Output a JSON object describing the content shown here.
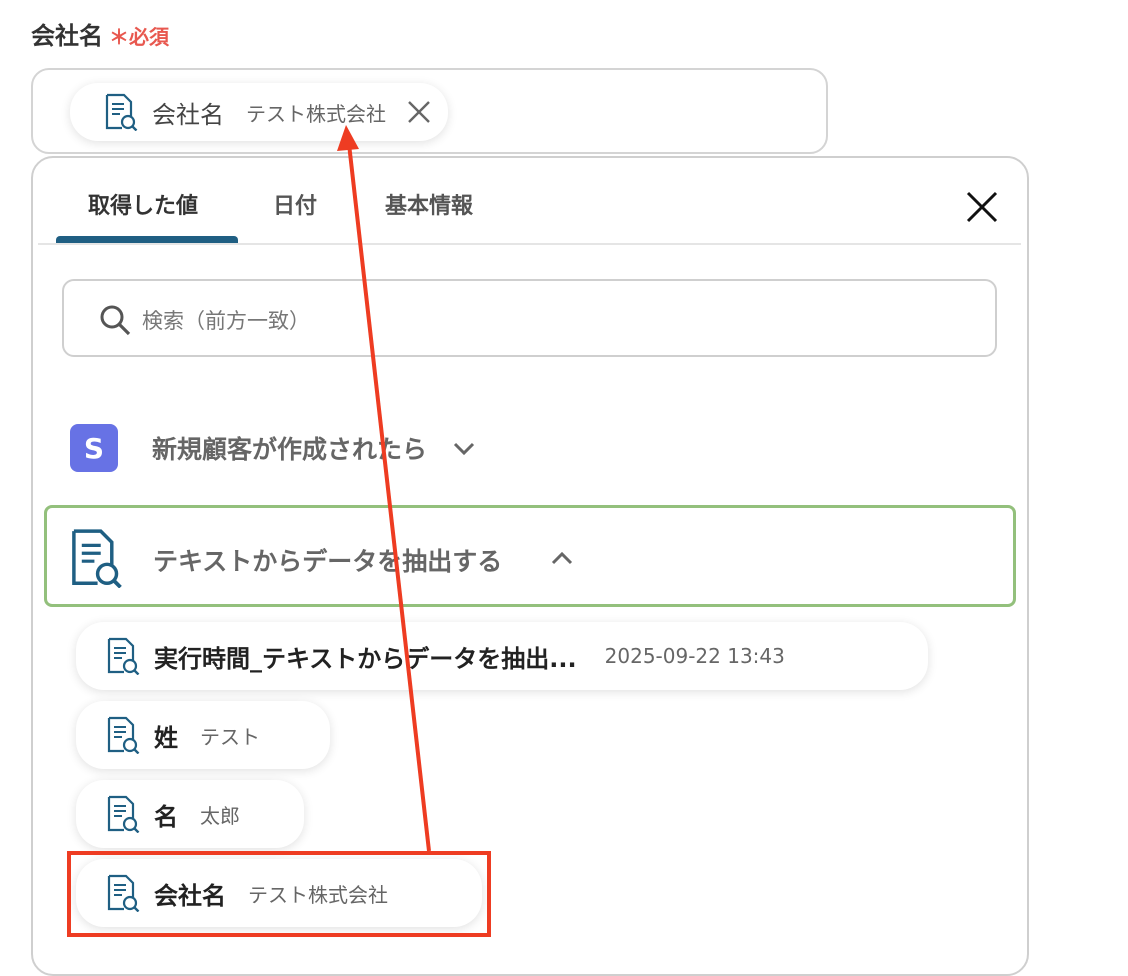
{
  "field": {
    "label": "会社名",
    "required_mark": "＊",
    "required_label": "必須"
  },
  "selected_chip": {
    "key": "会社名",
    "value": "テスト株式会社"
  },
  "tabs": [
    {
      "label": "取得した値",
      "active": true
    },
    {
      "label": "日付",
      "active": false
    },
    {
      "label": "基本情報",
      "active": false
    }
  ],
  "search": {
    "placeholder": "検索（前方一致）"
  },
  "sections": [
    {
      "title": "新規顧客が作成されたら",
      "badge": "S",
      "badge_color": "#6772e5",
      "expanded": false,
      "icon": "stripe-s-badge"
    },
    {
      "title": "テキストからデータを抽出する",
      "expanded": true,
      "icon": "document-search-icon"
    }
  ],
  "items": [
    {
      "key": "実行時間_テキストからデータを抽出...",
      "value": "2025-09-22 13:43"
    },
    {
      "key": "姓",
      "value": "テスト"
    },
    {
      "key": "名",
      "value": "太郎"
    },
    {
      "key": "会社名",
      "value": "テスト株式会社"
    }
  ],
  "colors": {
    "accent": "#1f5f83",
    "required": "#e8584f",
    "annotation": "#ee3c22",
    "section_border": "#93c07c"
  }
}
